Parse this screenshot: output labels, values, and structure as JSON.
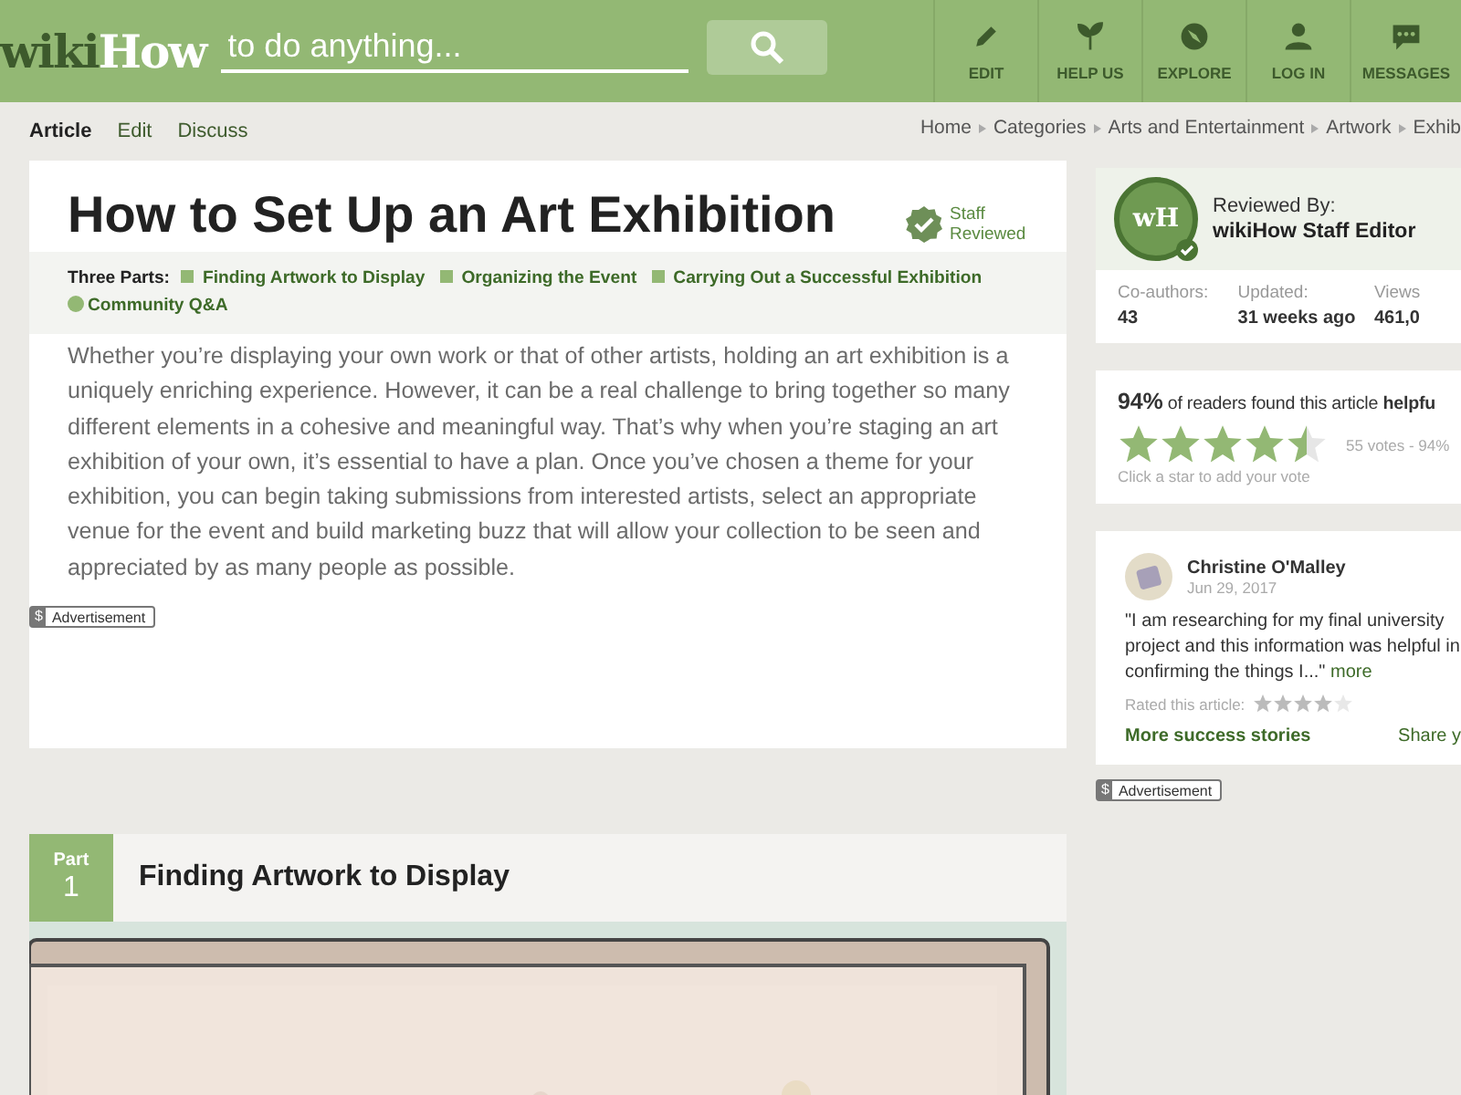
{
  "header": {
    "logo": {
      "part_1": "wiki",
      "part_2": "How"
    },
    "search": {
      "placeholder": "to do anything..."
    },
    "nav": [
      {
        "label": "EDIT"
      },
      {
        "label": "HELP US"
      },
      {
        "label": "EXPLORE"
      },
      {
        "label": "LOG IN"
      },
      {
        "label": "MESSAGES"
      }
    ]
  },
  "tabs": [
    {
      "label": "Article",
      "selected": true
    },
    {
      "label": "Edit",
      "selected": false
    },
    {
      "label": "Discuss",
      "selected": false
    }
  ],
  "breadcrumb": [
    "Home",
    "Categories",
    "Arts and Entertainment",
    "Artwork",
    "Exhib"
  ],
  "article": {
    "title": "How to Set Up an Art Exhibition",
    "badge": "Staff Reviewed",
    "parts_label": "Three Parts:",
    "parts": [
      "Finding Artwork to Display",
      "Organizing the Event",
      "Carrying Out a Successful Exhibition"
    ],
    "qa": "Community Q&A",
    "intro": "Whether you’re displaying your own work or that of other artists, holding an art exhibition is a uniquely enriching experience. However, it can be a real challenge to bring together so many different elements in a cohesive and meaningful way. That’s why when you’re staging an art exhibition of your own, it’s essential to have a plan. Once you’ve chosen a theme for your exhibition, you can begin taking submissions from interested artists, select an appropriate venue for the event and build marketing buzz that will allow your collection to be seen and appreciated by as many people as possible.",
    "ad": {
      "icon": "$",
      "label": "Advertisement"
    }
  },
  "section": {
    "part_label": "Part",
    "part_number": "1",
    "title": "Finding Artwork to Display"
  },
  "sidebar": {
    "reviewer": {
      "avatar": "wH",
      "label": "Reviewed By:",
      "name": "wikiHow Staff Editor"
    },
    "stats": [
      {
        "label": "Co-authors:",
        "value": "43"
      },
      {
        "label": "Updated:",
        "value": "31 weeks ago"
      },
      {
        "label": "Views",
        "value": "461,0"
      }
    ],
    "rating": {
      "percent": "94%",
      "sentence": "of readers found this article **helpfu**",
      "stars": 4.5,
      "votes": "55 votes - 94%",
      "hint": "Click a star to add your vote"
    },
    "story": {
      "name": "Christine O'Malley",
      "date": "Jun 29, 2017",
      "quote": "\"I am researching for my final university project and this information was helpful in confirming the things I...\"",
      "more": "more",
      "rated_label": "Rated this article:",
      "stars": 4,
      "more_stories": "More success stories",
      "share": "Share y"
    },
    "ad": {
      "icon": "$",
      "label": "Advertisement"
    }
  }
}
